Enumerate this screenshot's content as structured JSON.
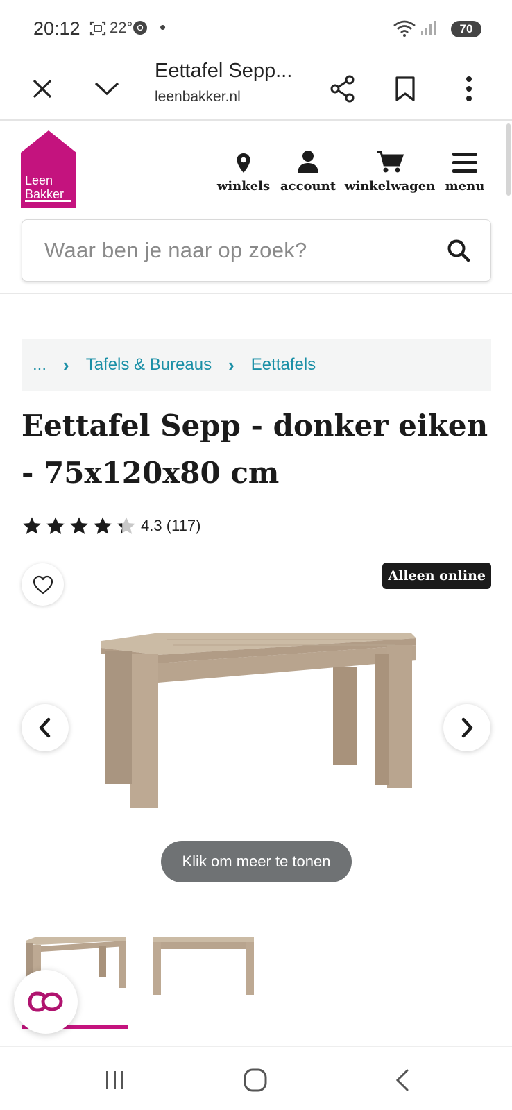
{
  "status_bar": {
    "time": "20:12",
    "temperature": "22°",
    "battery": "70"
  },
  "toolbar": {
    "title": "Eettafel Sepp...",
    "url": "leenbakker.nl"
  },
  "site": {
    "logo_line1": "Leen",
    "logo_line2": "Bakker",
    "brand_color": "#c4137e",
    "nav": [
      {
        "label": "winkels",
        "icon": "location-pin-icon"
      },
      {
        "label": "account",
        "icon": "user-icon"
      },
      {
        "label": "winkelwagen",
        "icon": "cart-icon"
      },
      {
        "label": "menu",
        "icon": "hamburger-icon"
      }
    ],
    "search_placeholder": "Waar ben je naar op zoek?"
  },
  "breadcrumb": {
    "ellipsis": "...",
    "items": [
      "Tafels & Bureaus",
      "Eettafels"
    ]
  },
  "product": {
    "title": "Eettafel Sepp - donker eiken - 75x120x80 cm",
    "rating_value": 4.3,
    "rating_text": "4.3 (117)",
    "badge": "Alleen online",
    "show_more": "Klik om meer te tonen",
    "thumbnails": 2,
    "active_thumbnail": 1
  }
}
